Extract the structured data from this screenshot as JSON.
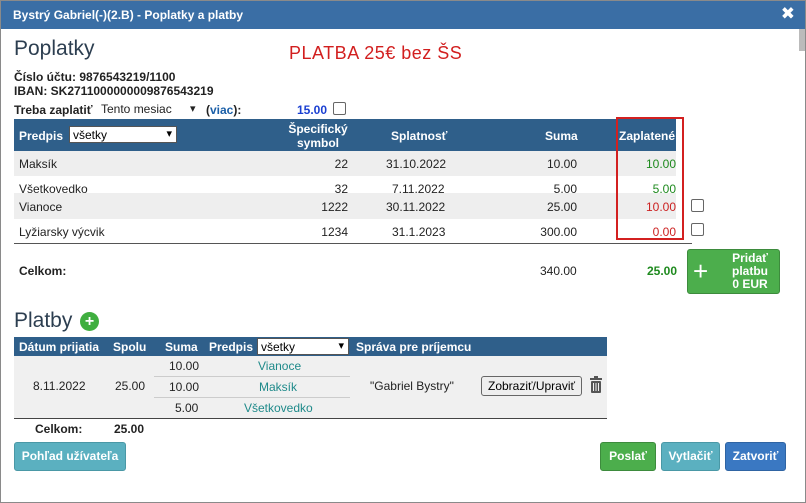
{
  "window": {
    "title": "Bystrý Gabriel(-)(2.B) - Poplatky a platby"
  },
  "fees": {
    "heading": "Poplatky",
    "note": "PLATBA 25€ bez ŠS",
    "account_line": "Číslo účtu: 9876543219/1100",
    "iban_line": "IBAN: SK2711000000009876543219",
    "due_label": "Treba zaplatiť",
    "period_select": "Tento mesiac",
    "more_open": "(",
    "more_link": "viac",
    "more_close": "):",
    "due_amount": "15.00",
    "columns": {
      "purpose": "Predpis",
      "purpose_filter": "všetky",
      "symbol_1": "Špecifický",
      "symbol_2": "symbol",
      "due_date": "Splatnosť",
      "amount": "Suma",
      "paid": "Zaplatené"
    },
    "rows": [
      {
        "name": "Maksík",
        "symbol": "22",
        "due": "31.10.2022",
        "amount": "10.00",
        "paid": "10.00",
        "paid_status": "green"
      },
      {
        "name": "Všetkovedko",
        "symbol": "32",
        "due": "7.11.2022",
        "amount": "5.00",
        "paid": "5.00",
        "paid_status": "green"
      },
      {
        "name": "Vianoce",
        "symbol": "1222",
        "due": "30.11.2022",
        "amount": "25.00",
        "paid": "10.00",
        "paid_status": "red"
      },
      {
        "name": "Lyžiarsky výcvik",
        "symbol": "1234",
        "due": "31.1.2023",
        "amount": "300.00",
        "paid": "0.00",
        "paid_status": "red"
      }
    ],
    "total_label": "Celkom:",
    "total_amount": "340.00",
    "total_paid": "25.00",
    "add_payment_button": {
      "line1": "Pridať",
      "line2": "platbu",
      "line3": "0 EUR"
    }
  },
  "payments": {
    "heading": "Platby",
    "columns": {
      "date": "Dátum prijatia",
      "total": "Spolu",
      "amount": "Suma",
      "purpose": "Predpis",
      "purpose_filter": "všetky",
      "message": "Správa pre príjemcu"
    },
    "entry": {
      "date": "8.11.2022",
      "total": "25.00",
      "items": [
        {
          "amount": "10.00",
          "purpose": "Vianoce"
        },
        {
          "amount": "10.00",
          "purpose": "Maksík"
        },
        {
          "amount": "5.00",
          "purpose": "Všetkovedko"
        }
      ],
      "message": "\"Gabriel Bystry\"",
      "view_edit_button": "Zobraziť/Upraviť"
    },
    "total_label": "Celkom:",
    "total_amount": "25.00"
  },
  "footer": {
    "user_view_button": "Pohľad užívateľa",
    "send_button": "Poslať",
    "print_button": "Vytlačiť",
    "close_button": "Zatvoriť"
  },
  "colors": {
    "header": "#2f5f8a",
    "titlebar": "#3a6ea5",
    "paid_ok": "#1e8a1e",
    "paid_due": "#cc2222",
    "note": "#d21f1f"
  }
}
